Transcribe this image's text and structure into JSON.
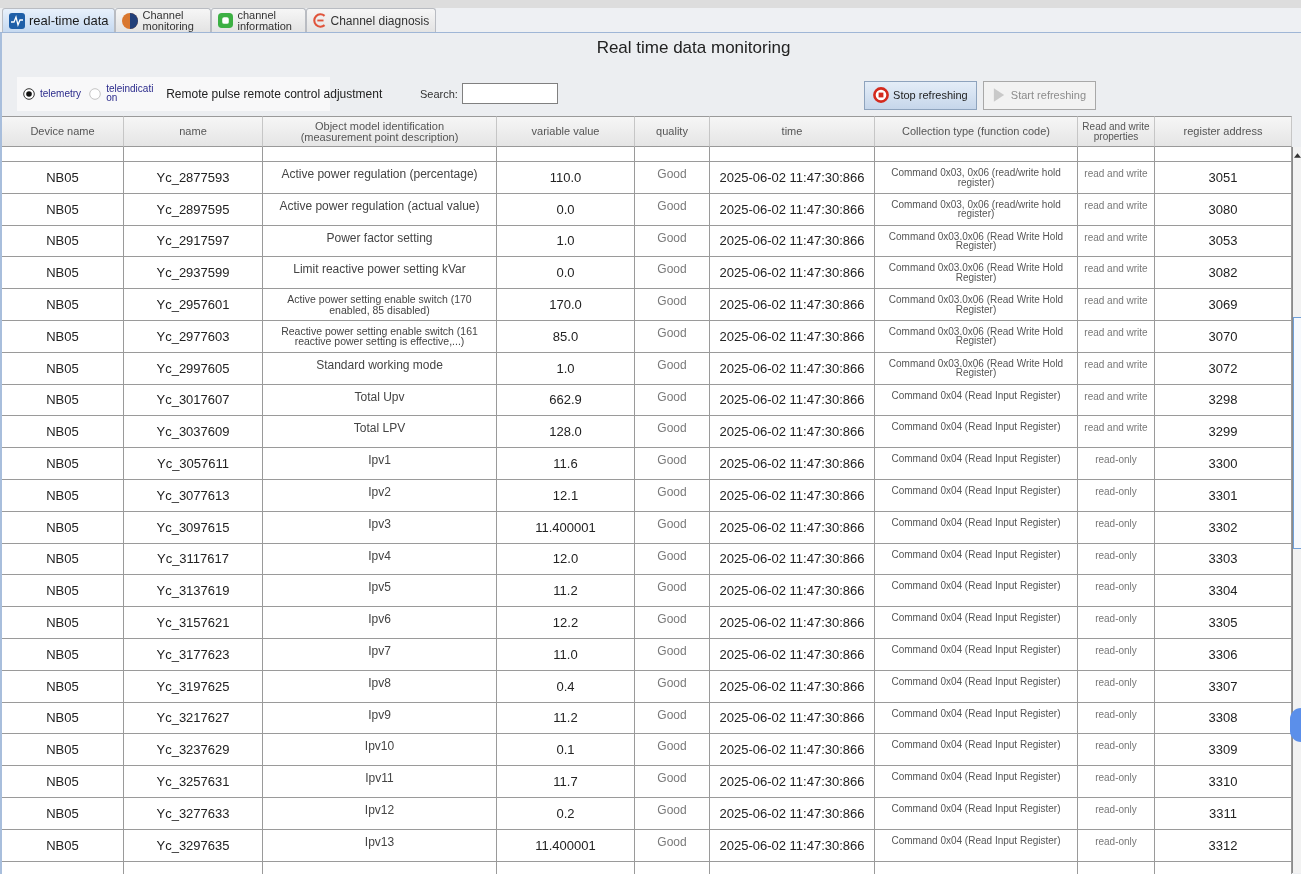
{
  "tabs": [
    {
      "label": "real-time data",
      "selected": true
    },
    {
      "label": "Channel monitoring",
      "selected": false
    },
    {
      "label": "channel information",
      "selected": false
    },
    {
      "label": "Channel diagnosis",
      "selected": false
    }
  ],
  "title": "Real time data monitoring",
  "toolbar": {
    "radios": [
      {
        "label": "telemetry",
        "selected": true
      },
      {
        "label": "teleindication",
        "selected": false
      }
    ],
    "mode_label": "Remote pulse remote control adjustment",
    "search": {
      "label": "Search:"
    },
    "buttons": [
      {
        "label": "Stop refreshing",
        "disabled": false
      },
      {
        "label": "Start refreshing",
        "disabled": true
      }
    ]
  },
  "table": {
    "columns": [
      "Device name",
      "name",
      "Object model identification (measurement point description)",
      "variable value",
      "quality",
      "time",
      "Collection type (function code)",
      "Read and write properties",
      "register address"
    ],
    "rows": [
      [
        "NB05",
        "Yc_2877593",
        "Active power regulation (percentage)",
        "110.0",
        "Good",
        "2025-06-02 11:47:30:866",
        "Command 0x03, 0x06 (read/write hold register)",
        "read and write",
        "3051"
      ],
      [
        "NB05",
        "Yc_2897595",
        "Active power regulation (actual value)",
        "0.0",
        "Good",
        "2025-06-02 11:47:30:866",
        "Command 0x03, 0x06 (read/write hold register)",
        "read and write",
        "3080"
      ],
      [
        "NB05",
        "Yc_2917597",
        "Power factor setting",
        "1.0",
        "Good",
        "2025-06-02 11:47:30:866",
        "Command 0x03.0x06 (Read Write Hold Register)",
        "read and write",
        "3053"
      ],
      [
        "NB05",
        "Yc_2937599",
        "Limit reactive power setting kVar",
        "0.0",
        "Good",
        "2025-06-02 11:47:30:866",
        "Command 0x03.0x06 (Read Write Hold Register)",
        "read and write",
        "3082"
      ],
      [
        "NB05",
        "Yc_2957601",
        "Active power setting enable switch (170 enabled, 85 disabled)",
        "170.0",
        "Good",
        "2025-06-02 11:47:30:866",
        "Command 0x03.0x06 (Read Write Hold Register)",
        "read and write",
        "3069"
      ],
      [
        "NB05",
        "Yc_2977603",
        "Reactive power setting enable switch (161 reactive power setting is effective,...)",
        "85.0",
        "Good",
        "2025-06-02 11:47:30:866",
        "Command 0x03.0x06 (Read Write Hold Register)",
        "read and write",
        "3070"
      ],
      [
        "NB05",
        "Yc_2997605",
        "Standard working mode",
        "1.0",
        "Good",
        "2025-06-02 11:47:30:866",
        "Command 0x03.0x06 (Read Write Hold Register)",
        "read and write",
        "3072"
      ],
      [
        "NB05",
        "Yc_3017607",
        "Total Upv",
        "662.9",
        "Good",
        "2025-06-02 11:47:30:866",
        "Command 0x04 (Read Input Register)",
        "read and write",
        "3298"
      ],
      [
        "NB05",
        "Yc_3037609",
        "Total LPV",
        "128.0",
        "Good",
        "2025-06-02 11:47:30:866",
        "Command 0x04 (Read Input Register)",
        "read and write",
        "3299"
      ],
      [
        "NB05",
        "Yc_3057611",
        "Ipv1",
        "11.6",
        "Good",
        "2025-06-02 11:47:30:866",
        "Command 0x04 (Read Input Register)",
        "read-only",
        "3300"
      ],
      [
        "NB05",
        "Yc_3077613",
        "Ipv2",
        "12.1",
        "Good",
        "2025-06-02 11:47:30:866",
        "Command 0x04 (Read Input Register)",
        "read-only",
        "3301"
      ],
      [
        "NB05",
        "Yc_3097615",
        "Ipv3",
        "11.400001",
        "Good",
        "2025-06-02 11:47:30:866",
        "Command 0x04 (Read Input Register)",
        "read-only",
        "3302"
      ],
      [
        "NB05",
        "Yc_3117617",
        "Ipv4",
        "12.0",
        "Good",
        "2025-06-02 11:47:30:866",
        "Command 0x04 (Read Input Register)",
        "read-only",
        "3303"
      ],
      [
        "NB05",
        "Yc_3137619",
        "Ipv5",
        "11.2",
        "Good",
        "2025-06-02 11:47:30:866",
        "Command 0x04 (Read Input Register)",
        "read-only",
        "3304"
      ],
      [
        "NB05",
        "Yc_3157621",
        "Ipv6",
        "12.2",
        "Good",
        "2025-06-02 11:47:30:866",
        "Command 0x04 (Read Input Register)",
        "read-only",
        "3305"
      ],
      [
        "NB05",
        "Yc_3177623",
        "Ipv7",
        "11.0",
        "Good",
        "2025-06-02 11:47:30:866",
        "Command 0x04 (Read Input Register)",
        "read-only",
        "3306"
      ],
      [
        "NB05",
        "Yc_3197625",
        "Ipv8",
        "0.4",
        "Good",
        "2025-06-02 11:47:30:866",
        "Command 0x04 (Read Input Register)",
        "read-only",
        "3307"
      ],
      [
        "NB05",
        "Yc_3217627",
        "Ipv9",
        "11.2",
        "Good",
        "2025-06-02 11:47:30:866",
        "Command 0x04 (Read Input Register)",
        "read-only",
        "3308"
      ],
      [
        "NB05",
        "Yc_3237629",
        "Ipv10",
        "0.1",
        "Good",
        "2025-06-02 11:47:30:866",
        "Command 0x04 (Read Input Register)",
        "read-only",
        "3309"
      ],
      [
        "NB05",
        "Yc_3257631",
        "Ipv11",
        "11.7",
        "Good",
        "2025-06-02 11:47:30:866",
        "Command 0x04 (Read Input Register)",
        "read-only",
        "3310"
      ],
      [
        "NB05",
        "Yc_3277633",
        "Ipv12",
        "0.2",
        "Good",
        "2025-06-02 11:47:30:866",
        "Command 0x04 (Read Input Register)",
        "read-only",
        "3311"
      ],
      [
        "NB05",
        "Yc_3297635",
        "Ipv13",
        "11.400001",
        "Good",
        "2025-06-02 11:47:30:866",
        "Command 0x04 (Read Input Register)",
        "read-only",
        "3312"
      ]
    ]
  }
}
